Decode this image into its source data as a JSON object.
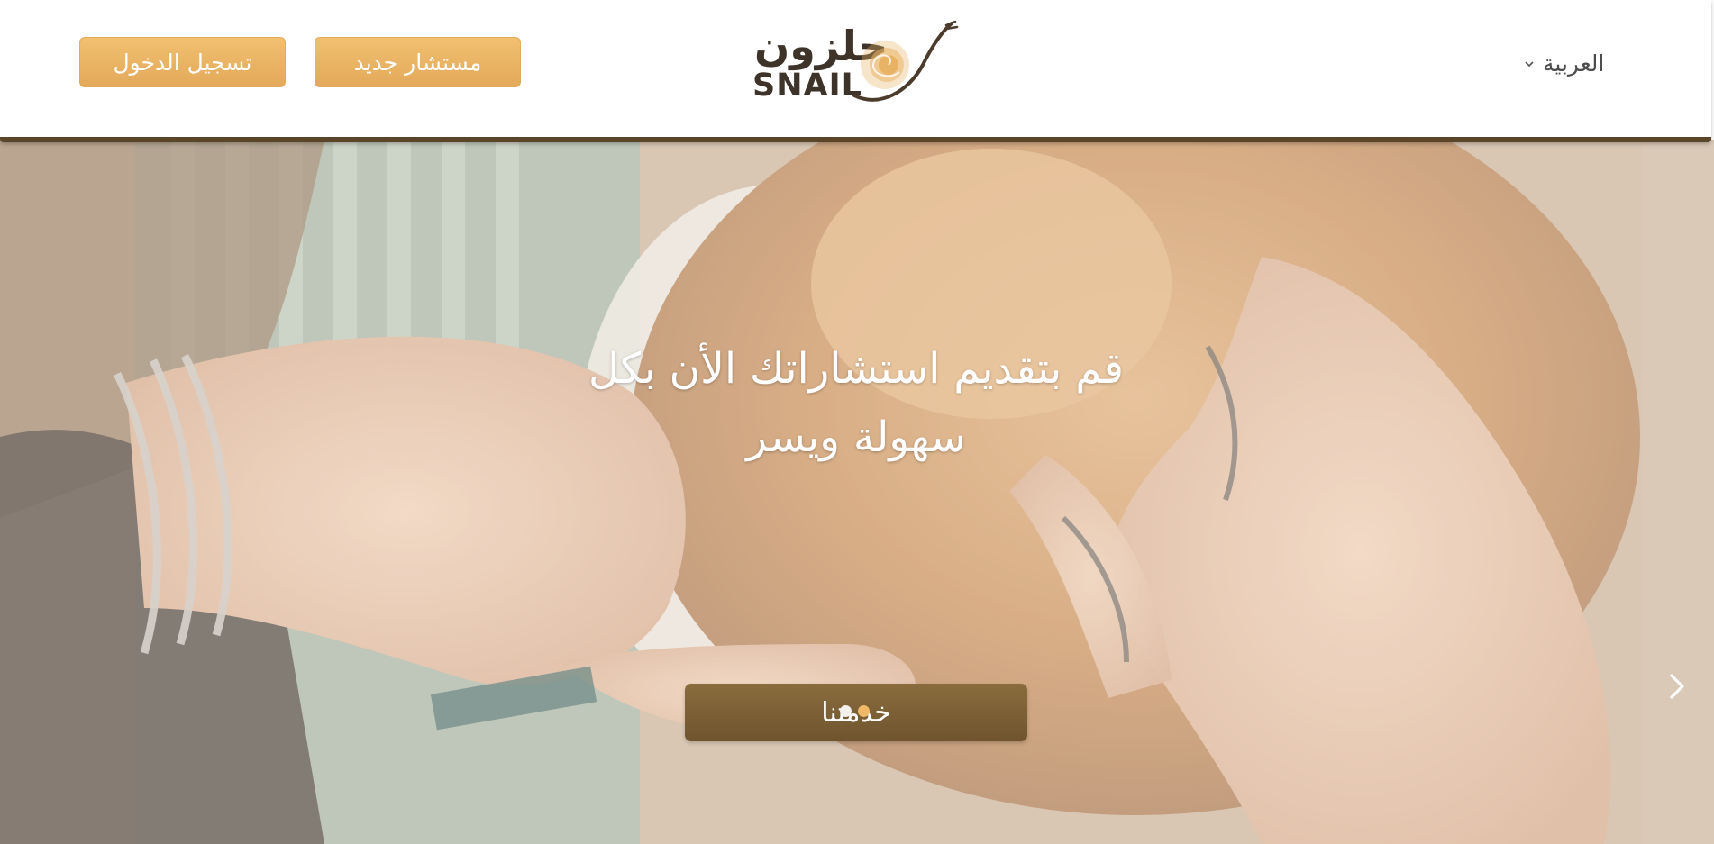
{
  "header": {
    "login_label": "تسجيل الدخول",
    "register_label": "مستشار جديد",
    "logo_ar": "حلزون",
    "logo_en": "SNAIL",
    "language_label": "العربية"
  },
  "hero": {
    "title": "قم بتقديم استشاراتك الأن بكل سهولة ويسر",
    "cta_label": "خدمتنا",
    "slides": [
      {
        "active": false
      },
      {
        "active": true
      }
    ]
  },
  "colors": {
    "accent": "#e8ae5f",
    "brand_brown": "#5a4529",
    "cta_brown": "#7d6236",
    "dot_inactive": "#f4f0ec",
    "dot_active": "#f1b867"
  },
  "icons": {
    "language_dropdown": "chevron-down-icon",
    "next_slide": "chevron-right-icon",
    "logo_mark": "snail-shell-icon"
  }
}
